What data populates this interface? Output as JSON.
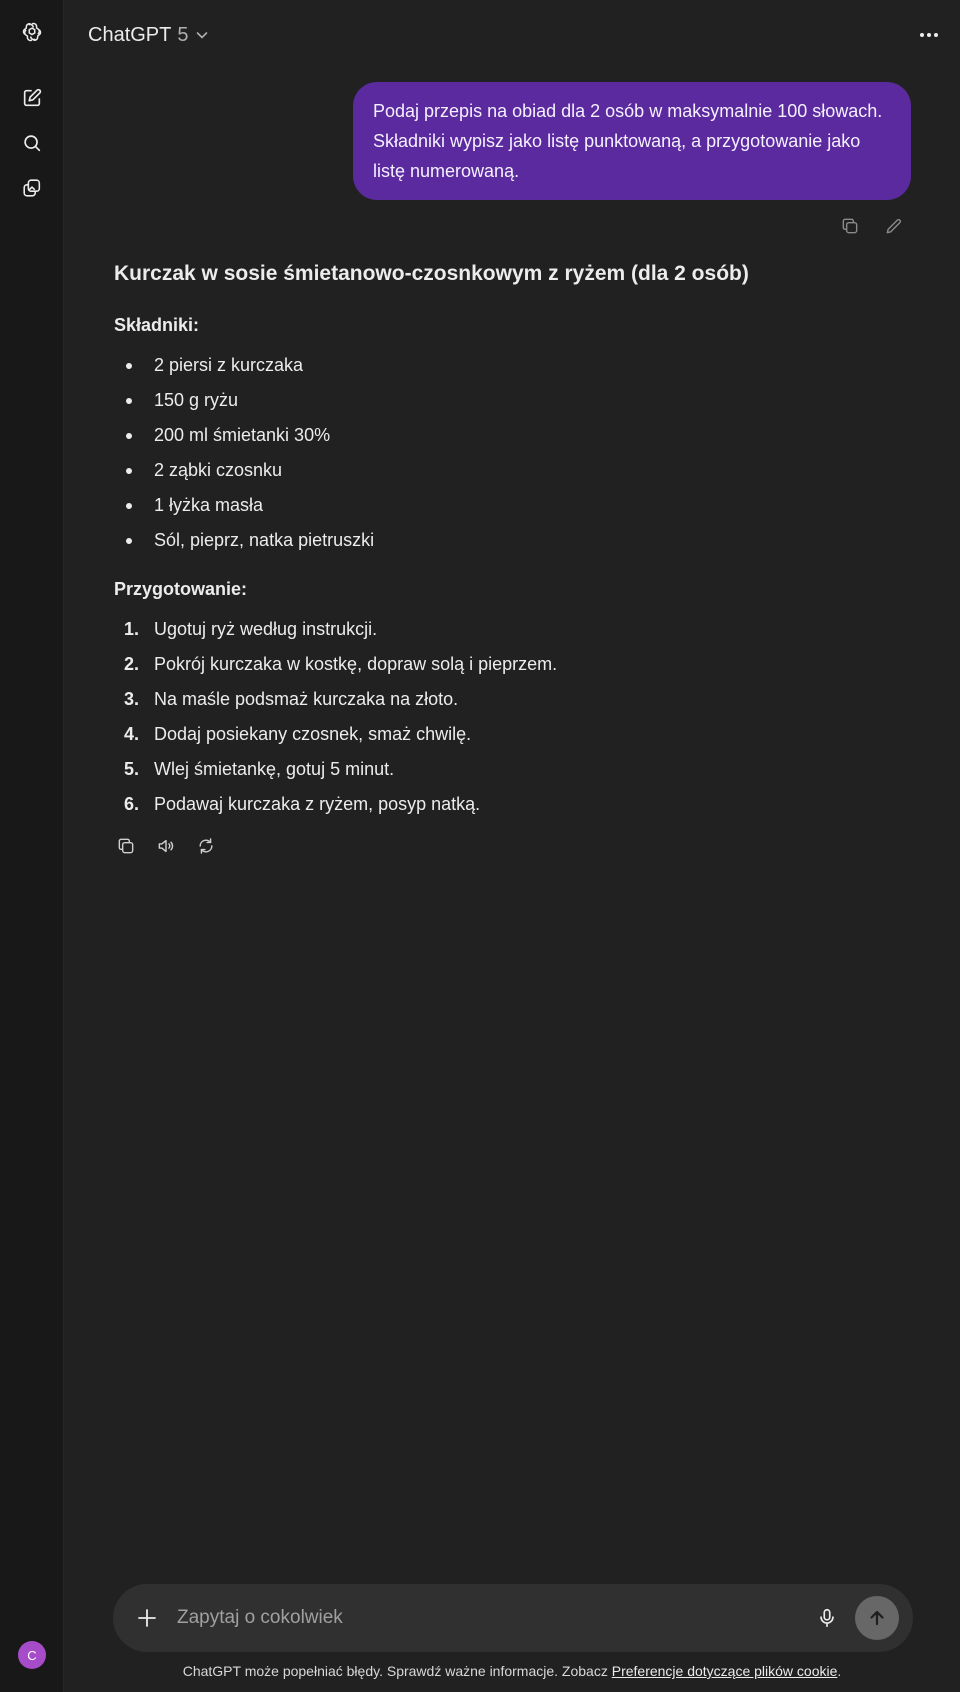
{
  "app": {
    "model_name": "ChatGPT",
    "model_version": "5"
  },
  "sidebar": {
    "avatar_initial": "C"
  },
  "user_message": {
    "text": "Podaj przepis na obiad dla 2 osób w maksymalnie 100 słowach. Składniki wypisz jako listę punktowaną, a przygotowanie jako listę numerowaną."
  },
  "assistant": {
    "title": "Kurczak w sosie śmietanowo-czosnkowym z ryżem (dla 2 osób)",
    "ingredients_heading": "Składniki:",
    "ingredients": [
      "2 piersi z kurczaka",
      "150 g ryżu",
      "200 ml śmietanki 30%",
      "2 ząbki czosnku",
      "1 łyżka masła",
      "Sól, pieprz, natka pietruszki"
    ],
    "steps_heading": "Przygotowanie:",
    "steps": [
      {
        "num": "1.",
        "text": "Ugotuj ryż według instrukcji."
      },
      {
        "num": "2.",
        "text": "Pokrój kurczaka w kostkę, dopraw solą i pieprzem."
      },
      {
        "num": "3.",
        "text": "Na maśle podsmaż kurczaka na złoto."
      },
      {
        "num": "4.",
        "text": "Dodaj posiekany czosnek, smaż chwilę."
      },
      {
        "num": "5.",
        "text": "Wlej śmietankę, gotuj 5 minut."
      },
      {
        "num": "6.",
        "text": "Podawaj kurczaka z ryżem, posyp natką."
      }
    ]
  },
  "composer": {
    "placeholder": "Zapytaj o cokolwiek"
  },
  "footer": {
    "text": "ChatGPT może popełniać błędy. Sprawdź ważne informacje. Zobacz ",
    "link": "Preferencje dotyczące plików cookie",
    "suffix": "."
  },
  "colors": {
    "background": "#212121",
    "sidebar": "#181818",
    "user_bubble": "#5a2a9e",
    "composer": "#303030",
    "avatar": "#a64cc9"
  }
}
